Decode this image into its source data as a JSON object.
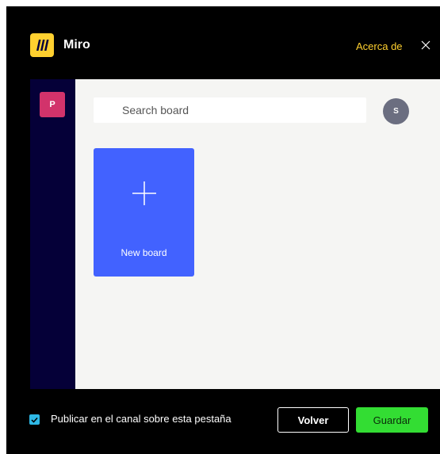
{
  "header": {
    "app_name": "Miro",
    "about_link": "Acerca de",
    "app_icon": "miro-logo-icon",
    "close_icon": "close-icon"
  },
  "sidebar": {
    "team_avatar_initial": "P"
  },
  "main": {
    "search": {
      "value": "",
      "placeholder": "Search board"
    },
    "user_avatar_initial": "S",
    "new_board": {
      "label": "New board",
      "icon": "plus-icon"
    }
  },
  "footer": {
    "publish_checkbox_checked": true,
    "publish_label": "Publicar en el canal sobre esta pestaña",
    "back_label": "Volver",
    "save_label": "Guardar"
  },
  "colors": {
    "dialog_background": "#000000",
    "accent_yellow": "#ffd02f",
    "sidebar_navy": "#050038",
    "board_blue": "#4262ff",
    "save_green": "#33dd33",
    "checkbox_blue": "#2eb8e6",
    "team_avatar_pink": "#d2336b"
  }
}
